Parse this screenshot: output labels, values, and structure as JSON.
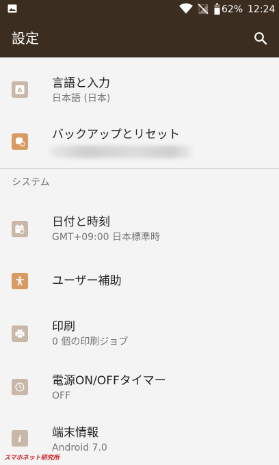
{
  "status_bar": {
    "battery": "62%",
    "time": "12:24"
  },
  "app_bar": {
    "title": "設定",
    "search_icon": "search-icon"
  },
  "rows": [
    {
      "id": "language",
      "title": "言語と入力",
      "summary": "日本語 (日本)",
      "icon": "language-icon",
      "icon_color": "#c8b8a8"
    },
    {
      "id": "backup",
      "title": "バックアップとリセット",
      "summary": "",
      "icon": "backup-icon",
      "icon_color": "#d89a60"
    }
  ],
  "sections": [
    {
      "header": "システム"
    }
  ],
  "system_rows": [
    {
      "id": "date-time",
      "title": "日付と時刻",
      "summary": "GMT+09:00 日本標準時",
      "icon": "calendar-icon",
      "icon_color": "#c8b8a8"
    },
    {
      "id": "accessibility",
      "title": "ユーザー補助",
      "summary": "",
      "icon": "accessibility-icon",
      "icon_color": "#d89a60"
    },
    {
      "id": "printing",
      "title": "印刷",
      "summary": "0 個の印刷ジョブ",
      "icon": "print-icon",
      "icon_color": "#c8b8a8"
    },
    {
      "id": "power-timer",
      "title": "電源ON/OFFタイマー",
      "summary": "OFF",
      "icon": "clock-icon",
      "icon_color": "#c8b8a8"
    },
    {
      "id": "about",
      "title": "端末情報",
      "summary": "Android 7.0",
      "icon": "info-icon",
      "icon_color": "#c8b8a8"
    }
  ],
  "watermark": "スマホネット研究所"
}
